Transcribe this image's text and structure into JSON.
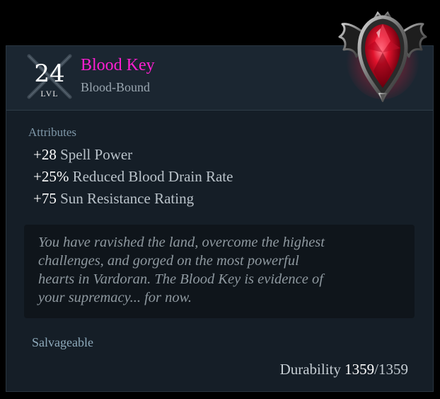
{
  "item": {
    "level": "24",
    "level_label": "LVL",
    "name": "Blood Key",
    "binding": "Blood-Bound",
    "icon": "blood-key-gem-icon"
  },
  "attributes": {
    "title": "Attributes",
    "items": [
      {
        "value": "+28",
        "text": " Spell Power"
      },
      {
        "value": "+25%",
        "text": " Reduced Blood Drain Rate"
      },
      {
        "value": "+75",
        "text": " Sun Resistance Rating"
      }
    ]
  },
  "flavor_lines": [
    "You have ravished the land, overcome the highest",
    "challenges, and gorged on the most powerful",
    "hearts in Vardoran. The Blood Key is evidence of",
    "your supremacy... for now."
  ],
  "salvage_label": "Salvageable",
  "durability": {
    "label": "Durability ",
    "current": "1359",
    "max": "/1359"
  },
  "colors": {
    "item_name": "#ff1fd2",
    "background": "#151e27",
    "header": "#1b2631",
    "gem": "#e0122c"
  }
}
